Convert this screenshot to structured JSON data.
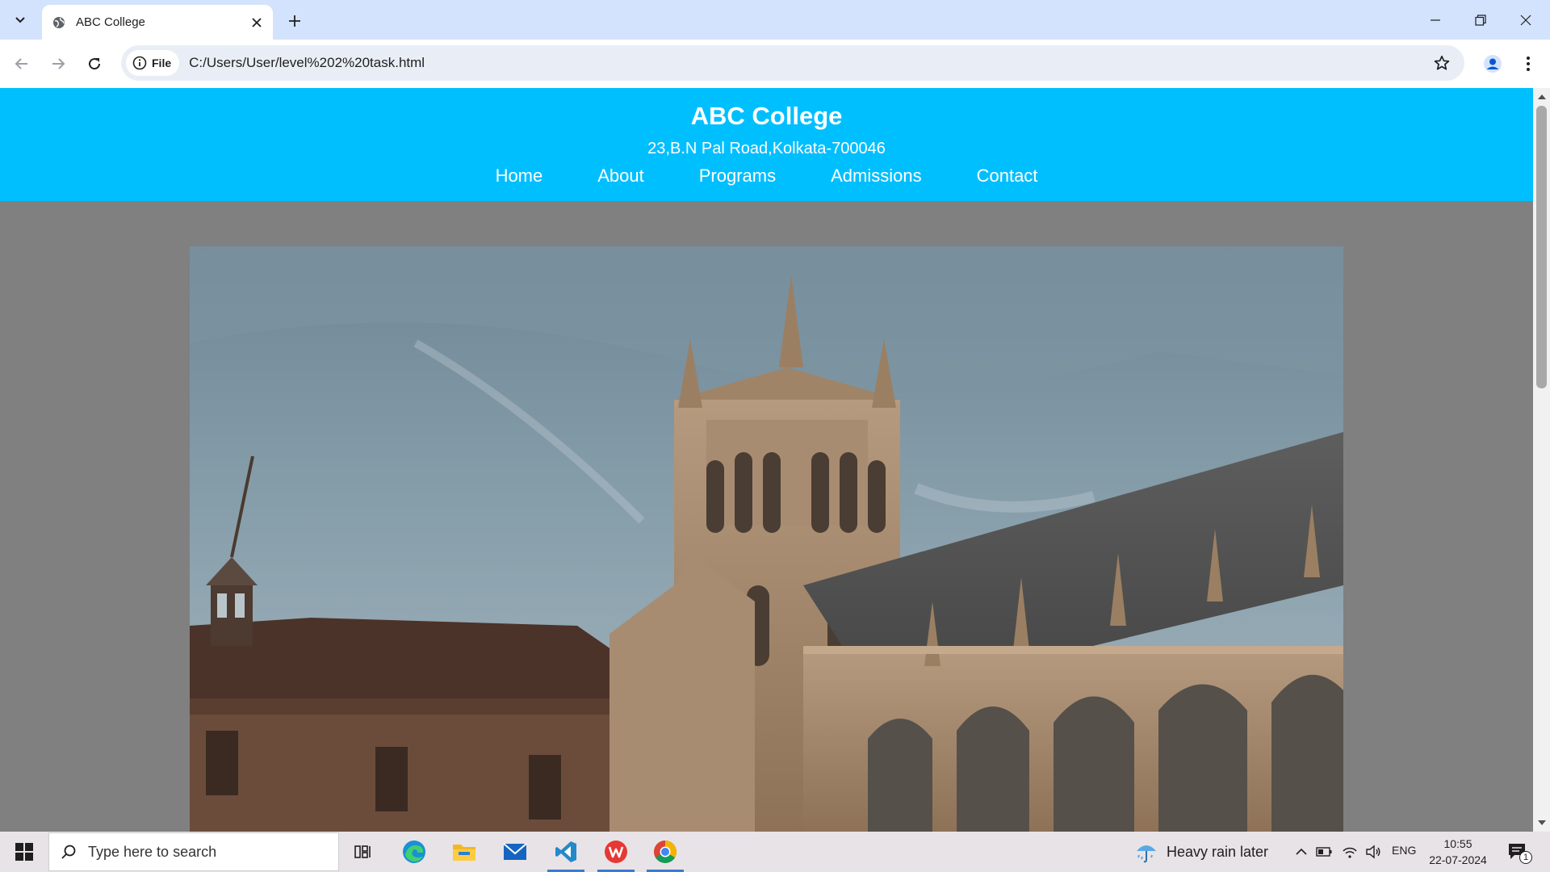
{
  "browser": {
    "tab": {
      "title": "ABC College"
    },
    "omnibox": {
      "chip_label": "File",
      "url": "C:/Users/User/level%202%20task.html"
    }
  },
  "page": {
    "header": {
      "title": "ABC College",
      "address": "23,B.N Pal Road,Kolkata-700046"
    },
    "nav": [
      {
        "label": "Home"
      },
      {
        "label": "About"
      },
      {
        "label": "Programs"
      },
      {
        "label": "Admissions"
      },
      {
        "label": "Contact"
      }
    ],
    "hero": {
      "icon": "college-building-photo"
    },
    "colors": {
      "header_bg": "#00bfff",
      "page_bg": "#808080"
    }
  },
  "taskbar": {
    "search_placeholder": "Type here to search",
    "weather": "Heavy rain later",
    "language": "ENG",
    "time": "10:55",
    "date": "22-07-2024",
    "notification_count": "1"
  }
}
